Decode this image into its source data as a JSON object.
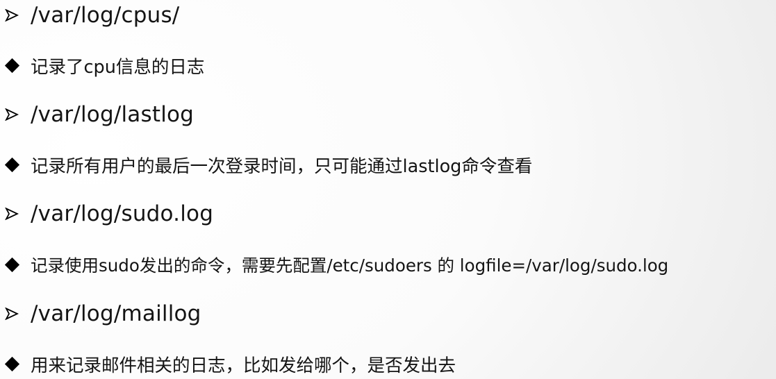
{
  "items": [
    {
      "type": "heading",
      "bullet_icon": "arrow-bullet-icon",
      "text": "/var/log/cpus/"
    },
    {
      "type": "desc",
      "bullet_icon": "diamond-bullet-icon",
      "text": "记录了cpu信息的日志"
    },
    {
      "type": "heading",
      "bullet_icon": "arrow-bullet-icon",
      "text": "/var/log/lastlog"
    },
    {
      "type": "desc",
      "bullet_icon": "diamond-bullet-icon",
      "text": "记录所有用户的最后一次登录时间，只可能通过lastlog命令查看"
    },
    {
      "type": "heading",
      "bullet_icon": "arrow-bullet-icon",
      "text": "/var/log/sudo.log"
    },
    {
      "type": "desc",
      "bullet_icon": "diamond-bullet-icon",
      "text": "记录使用sudo发出的命令，需要先配置/etc/sudoers 的 logfile=/var/log/sudo.log"
    },
    {
      "type": "heading",
      "bullet_icon": "arrow-bullet-icon",
      "text": "/var/log/maillog"
    },
    {
      "type": "desc",
      "bullet_icon": "diamond-bullet-icon",
      "text": "用来记录邮件相关的日志，比如发给哪个，是否发出去"
    }
  ]
}
